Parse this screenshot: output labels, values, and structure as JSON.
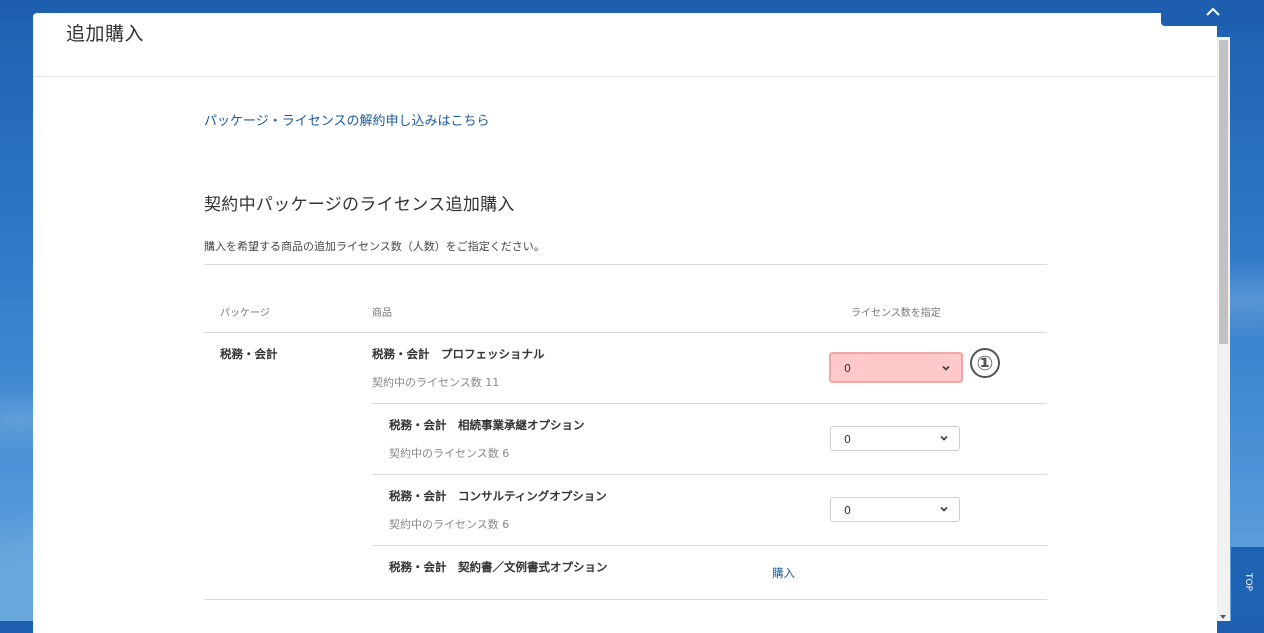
{
  "header": {
    "title": "追加購入"
  },
  "cancel_link": "パッケージ・ライセンスの解約申し込みはこちら",
  "section": {
    "title": "契約中パッケージのライセンス追加購入",
    "description": "購入を希望する商品の追加ライセンス数（人数）をご指定ください。"
  },
  "table": {
    "headers": {
      "package": "パッケージ",
      "product": "商品",
      "license": "ライセンス数を指定"
    },
    "package_name": "税務・会計",
    "rows": [
      {
        "product": "税務・会計　プロフェッショナル",
        "contracted": "契約中のライセンス数 11",
        "value": "0"
      },
      {
        "product": "税務・会計　相続事業承継オプション",
        "contracted": "契約中のライセンス数 6",
        "value": "0"
      },
      {
        "product": "税務・会計　コンサルティングオプション",
        "contracted": "契約中のライセンス数 6",
        "value": "0"
      },
      {
        "product": "税務・会計　契約書／文例書式オプション",
        "buy_label": "購入"
      }
    ]
  },
  "annotation": {
    "marker": "①"
  },
  "side_nav": {
    "top_label": "TOP"
  },
  "colors": {
    "highlight": "#ffc9c9",
    "link": "#1a5a9c",
    "brand": "#1d5fae"
  },
  "icons": {
    "select_chevron": "chevron-down-icon",
    "top_tab": "chevron-up-icon"
  }
}
